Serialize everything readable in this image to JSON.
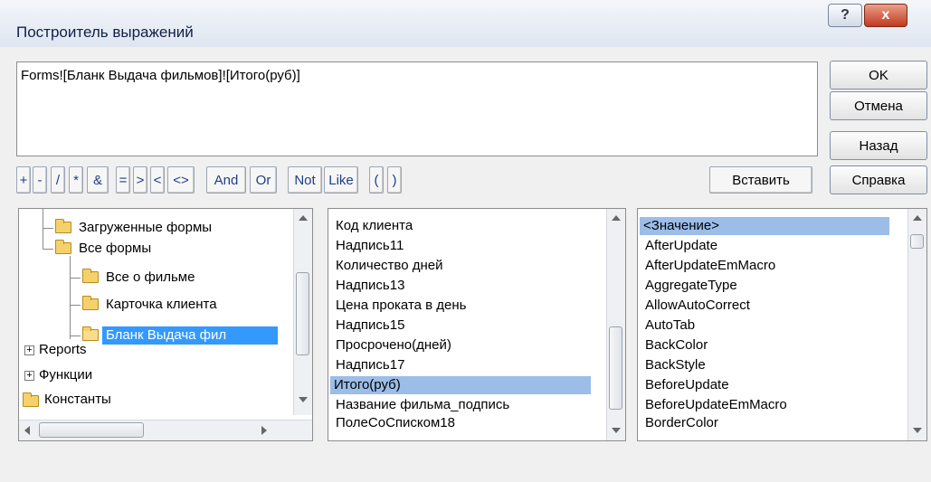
{
  "window": {
    "title": "Построитель выражений",
    "help_glyph": "?",
    "close_glyph": "x"
  },
  "expression": "Forms![Бланк Выдача фильмов]![Итого(руб)]",
  "buttons": {
    "ok": "OK",
    "cancel": "Отмена",
    "back": "Назад",
    "help": "Справка",
    "paste": "Вставить"
  },
  "operators": [
    "+",
    "-",
    "/",
    "*",
    "&",
    "=",
    ">",
    "<",
    "<>",
    "And",
    "Or",
    "Not",
    "Like",
    "(",
    ")"
  ],
  "tree": {
    "items": [
      {
        "label": "Загруженные формы",
        "icon": "folder-icon"
      },
      {
        "label": "Все формы",
        "icon": "folder-icon"
      },
      {
        "label": "Все о фильме",
        "icon": "folder-icon"
      },
      {
        "label": "Карточка клиента",
        "icon": "folder-icon"
      },
      {
        "label": "Бланк Выдача фил",
        "icon": "open-folder-icon",
        "selected": true
      },
      {
        "label": "Reports",
        "icon": "expand-icon"
      },
      {
        "label": "Функции",
        "icon": "expand-icon"
      },
      {
        "label": "Константы",
        "icon": "folder-icon"
      }
    ]
  },
  "fields": {
    "items": [
      "Код клиента",
      "Надпись11",
      "Количество дней",
      "Надпись13",
      "Цена проката в день",
      "Надпись15",
      "Просрочено(дней)",
      "Надпись17",
      "Итого(руб)",
      "Название фильма_подпись",
      "ПолеСоСписком18"
    ],
    "selected": "Итого(руб)"
  },
  "properties": {
    "items": [
      "<Значение>",
      "AfterUpdate",
      "AfterUpdateEmMacro",
      "AggregateType",
      "AllowAutoCorrect",
      "AutoTab",
      "BackColor",
      "BackStyle",
      "BeforeUpdate",
      "BeforeUpdateEmMacro",
      "BorderColor"
    ],
    "selected": "<Значение>"
  }
}
